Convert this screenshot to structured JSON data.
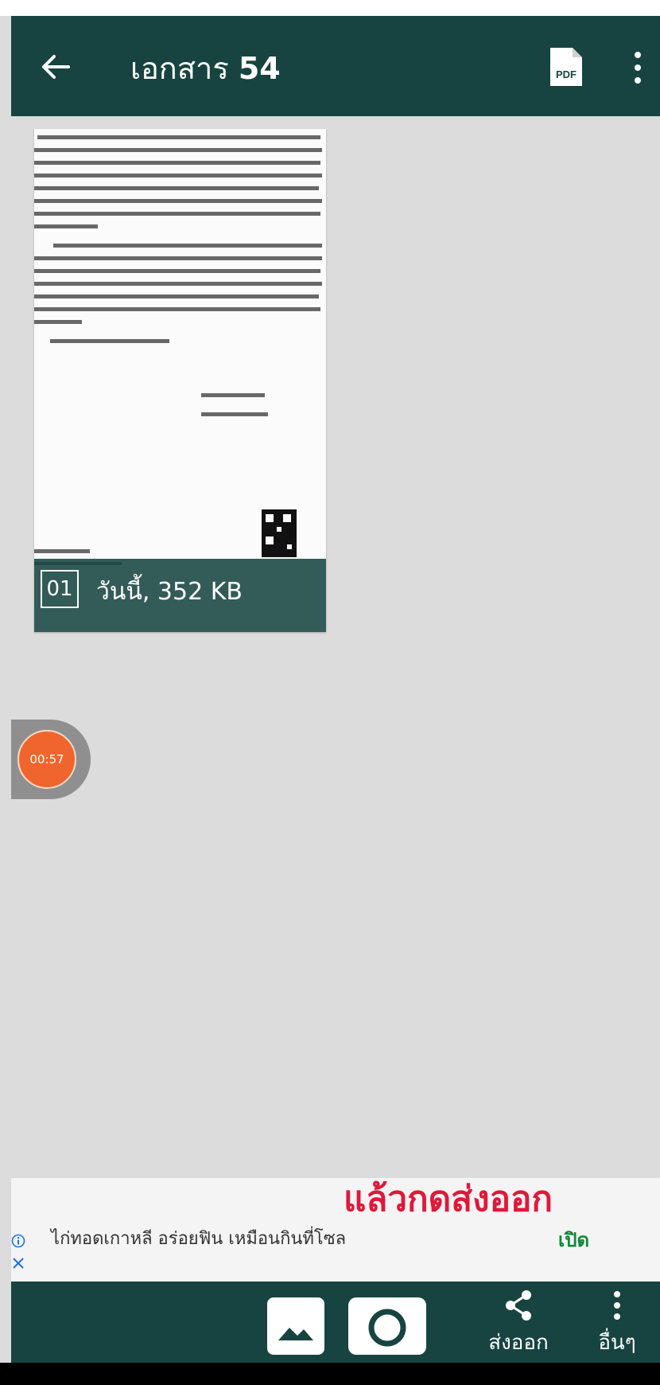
{
  "header": {
    "title_prefix": "เอกสาร",
    "title_number": "54",
    "back_icon": "arrow-left-icon",
    "pdf_icon": "pdf-file-icon",
    "pdf_label": "PDF",
    "menu_icon": "more-vertical-icon"
  },
  "document": {
    "page_number": "01",
    "meta": "วันนี้, 352 KB"
  },
  "recorder": {
    "elapsed": "00:57"
  },
  "ad": {
    "overlay_text": "แล้วกดส่งออก",
    "text": "ไก่ทอดเกาหลี อร่อยฟิน เหมือนกินที่โซล",
    "open_label": "เปิด",
    "info_icon": "info-icon",
    "close_icon": "close-icon"
  },
  "toolbar": {
    "gallery_icon": "image-icon",
    "camera_icon": "camera-icon",
    "share_label": "ส่งออก",
    "share_icon": "share-icon",
    "other_label": "อื่นๆ",
    "other_icon": "more-vertical-icon"
  },
  "colors": {
    "primary": "#174440",
    "accent_timer": "#f0652d",
    "ad_headline": "#e0183a",
    "ad_open": "#0c8a3a",
    "background": "#dcdcdc"
  }
}
